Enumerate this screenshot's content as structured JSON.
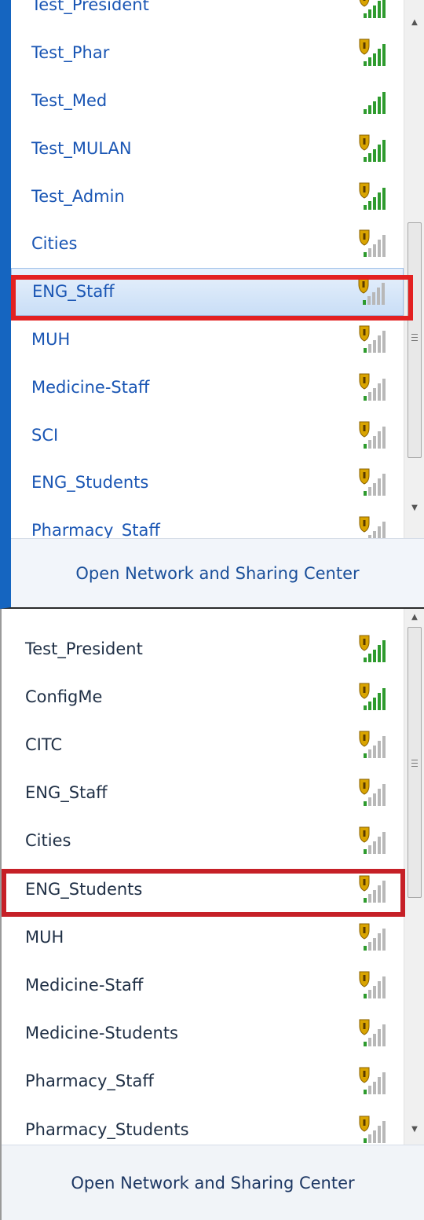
{
  "panel1": {
    "networks": [
      {
        "name": "Test_President",
        "secured": true,
        "strength": 5
      },
      {
        "name": "Test_Phar",
        "secured": true,
        "strength": 5
      },
      {
        "name": "Test_Med",
        "secured": false,
        "strength": 5
      },
      {
        "name": "Test_MULAN",
        "secured": true,
        "strength": 5
      },
      {
        "name": "Test_Admin",
        "secured": true,
        "strength": 5
      },
      {
        "name": "Cities",
        "secured": true,
        "strength": 1
      },
      {
        "name": "ENG_Staff",
        "secured": true,
        "strength": 1
      },
      {
        "name": "MUH",
        "secured": true,
        "strength": 1
      },
      {
        "name": "Medicine-Staff",
        "secured": true,
        "strength": 1
      },
      {
        "name": "SCI",
        "secured": true,
        "strength": 1
      },
      {
        "name": "ENG_Students",
        "secured": true,
        "strength": 1
      },
      {
        "name": "Pharmacy_Staff",
        "secured": true,
        "strength": 1
      }
    ],
    "selected_network": "ENG_Staff",
    "footer_link": "Open Network and Sharing Center"
  },
  "panel2": {
    "networks": [
      {
        "name": "Test_President",
        "secured": true,
        "strength": 5
      },
      {
        "name": "ConfigMe",
        "secured": true,
        "strength": 5
      },
      {
        "name": "CITC",
        "secured": true,
        "strength": 1
      },
      {
        "name": "ENG_Staff",
        "secured": true,
        "strength": 1
      },
      {
        "name": "Cities",
        "secured": true,
        "strength": 1
      },
      {
        "name": "ENG_Students",
        "secured": true,
        "strength": 1
      },
      {
        "name": "MUH",
        "secured": true,
        "strength": 1
      },
      {
        "name": "Medicine-Staff",
        "secured": true,
        "strength": 1
      },
      {
        "name": "Medicine-Students",
        "secured": true,
        "strength": 1
      },
      {
        "name": "Pharmacy_Staff",
        "secured": true,
        "strength": 1
      },
      {
        "name": "Pharmacy_Students",
        "secured": true,
        "strength": 1
      }
    ],
    "selected_network": "ENG_Students",
    "footer_link": "Open Network and Sharing Center"
  },
  "icons": {
    "signal": "wifi-signal-icon",
    "shield": "security-shield-icon",
    "scroll_up": "scroll-up-arrow-icon",
    "scroll_down": "scroll-down-arrow-icon"
  },
  "colors": {
    "panel1_accent_border": "#1565c0",
    "highlight_panel1": "#e32121",
    "highlight_panel2": "#c62027",
    "signal_green": "#2e9b2e",
    "signal_gray": "#b8b8b8",
    "shield_gold": "#d9a400",
    "link_blue": "#1a56b4"
  }
}
